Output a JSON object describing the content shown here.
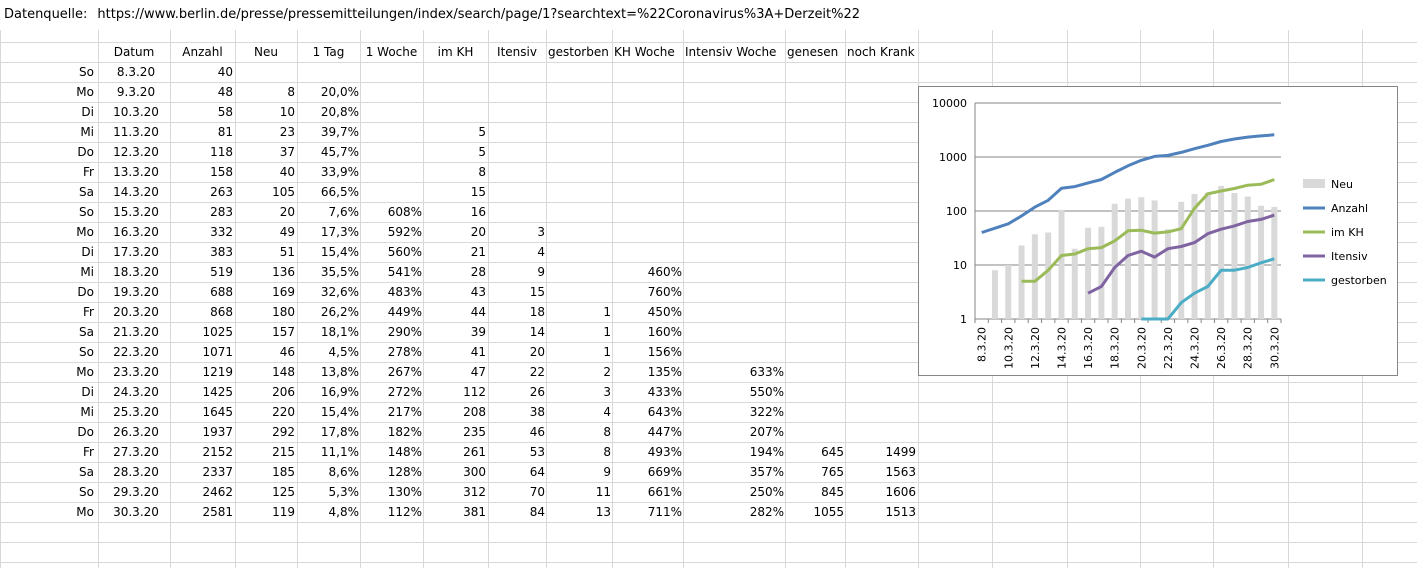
{
  "source": {
    "label": "Datenquelle:",
    "url": "https://www.berlin.de/presse/pressemitteilungen/index/search/page/1?searchtext=%22Coronavirus%3A+Derzeit%22"
  },
  "table": {
    "headers": [
      "Datum",
      "Anzahl",
      "Neu",
      "1 Tag",
      "1 Woche",
      "im KH",
      "Itensiv",
      "gestorben",
      "KH Woche",
      "Intensiv Woche",
      "genesen",
      "noch Krank"
    ],
    "rows": [
      {
        "day": "So",
        "datum": "8.3.20",
        "anzahl": "40",
        "neu": "",
        "tag1": "",
        "woche1": "",
        "kh": "",
        "intensiv": "",
        "gestorben": "",
        "khwoche": "",
        "intwoche": "",
        "genesen": "",
        "krank": ""
      },
      {
        "day": "Mo",
        "datum": "9.3.20",
        "anzahl": "48",
        "neu": "8",
        "tag1": "20,0%",
        "woche1": "",
        "kh": "",
        "intensiv": "",
        "gestorben": "",
        "khwoche": "",
        "intwoche": "",
        "genesen": "",
        "krank": ""
      },
      {
        "day": "Di",
        "datum": "10.3.20",
        "anzahl": "58",
        "neu": "10",
        "tag1": "20,8%",
        "woche1": "",
        "kh": "",
        "intensiv": "",
        "gestorben": "",
        "khwoche": "",
        "intwoche": "",
        "genesen": "",
        "krank": ""
      },
      {
        "day": "Mi",
        "datum": "11.3.20",
        "anzahl": "81",
        "neu": "23",
        "tag1": "39,7%",
        "woche1": "",
        "kh": "5",
        "intensiv": "",
        "gestorben": "",
        "khwoche": "",
        "intwoche": "",
        "genesen": "",
        "krank": ""
      },
      {
        "day": "Do",
        "datum": "12.3.20",
        "anzahl": "118",
        "neu": "37",
        "tag1": "45,7%",
        "woche1": "",
        "kh": "5",
        "intensiv": "",
        "gestorben": "",
        "khwoche": "",
        "intwoche": "",
        "genesen": "",
        "krank": ""
      },
      {
        "day": "Fr",
        "datum": "13.3.20",
        "anzahl": "158",
        "neu": "40",
        "tag1": "33,9%",
        "woche1": "",
        "kh": "8",
        "intensiv": "",
        "gestorben": "",
        "khwoche": "",
        "intwoche": "",
        "genesen": "",
        "krank": ""
      },
      {
        "day": "Sa",
        "datum": "14.3.20",
        "anzahl": "263",
        "neu": "105",
        "tag1": "66,5%",
        "woche1": "",
        "kh": "15",
        "intensiv": "",
        "gestorben": "",
        "khwoche": "",
        "intwoche": "",
        "genesen": "",
        "krank": ""
      },
      {
        "day": "So",
        "datum": "15.3.20",
        "anzahl": "283",
        "neu": "20",
        "tag1": "7,6%",
        "woche1": "608%",
        "kh": "16",
        "intensiv": "",
        "gestorben": "",
        "khwoche": "",
        "intwoche": "",
        "genesen": "",
        "krank": ""
      },
      {
        "day": "Mo",
        "datum": "16.3.20",
        "anzahl": "332",
        "neu": "49",
        "tag1": "17,3%",
        "woche1": "592%",
        "kh": "20",
        "intensiv": "3",
        "gestorben": "",
        "khwoche": "",
        "intwoche": "",
        "genesen": "",
        "krank": ""
      },
      {
        "day": "Di",
        "datum": "17.3.20",
        "anzahl": "383",
        "neu": "51",
        "tag1": "15,4%",
        "woche1": "560%",
        "kh": "21",
        "intensiv": "4",
        "gestorben": "",
        "khwoche": "",
        "intwoche": "",
        "genesen": "",
        "krank": ""
      },
      {
        "day": "Mi",
        "datum": "18.3.20",
        "anzahl": "519",
        "neu": "136",
        "tag1": "35,5%",
        "woche1": "541%",
        "kh": "28",
        "intensiv": "9",
        "gestorben": "",
        "khwoche": "460%",
        "intwoche": "",
        "genesen": "",
        "krank": ""
      },
      {
        "day": "Do",
        "datum": "19.3.20",
        "anzahl": "688",
        "neu": "169",
        "tag1": "32,6%",
        "woche1": "483%",
        "kh": "43",
        "intensiv": "15",
        "gestorben": "",
        "khwoche": "760%",
        "intwoche": "",
        "genesen": "",
        "krank": ""
      },
      {
        "day": "Fr",
        "datum": "20.3.20",
        "anzahl": "868",
        "neu": "180",
        "tag1": "26,2%",
        "woche1": "449%",
        "kh": "44",
        "intensiv": "18",
        "gestorben": "1",
        "khwoche": "450%",
        "intwoche": "",
        "genesen": "",
        "krank": ""
      },
      {
        "day": "Sa",
        "datum": "21.3.20",
        "anzahl": "1025",
        "neu": "157",
        "tag1": "18,1%",
        "woche1": "290%",
        "kh": "39",
        "intensiv": "14",
        "gestorben": "1",
        "khwoche": "160%",
        "intwoche": "",
        "genesen": "",
        "krank": ""
      },
      {
        "day": "So",
        "datum": "22.3.20",
        "anzahl": "1071",
        "neu": "46",
        "tag1": "4,5%",
        "woche1": "278%",
        "kh": "41",
        "intensiv": "20",
        "gestorben": "1",
        "khwoche": "156%",
        "intwoche": "",
        "genesen": "",
        "krank": ""
      },
      {
        "day": "Mo",
        "datum": "23.3.20",
        "anzahl": "1219",
        "neu": "148",
        "tag1": "13,8%",
        "woche1": "267%",
        "kh": "47",
        "intensiv": "22",
        "gestorben": "2",
        "khwoche": "135%",
        "intwoche": "633%",
        "genesen": "",
        "krank": ""
      },
      {
        "day": "Di",
        "datum": "24.3.20",
        "anzahl": "1425",
        "neu": "206",
        "tag1": "16,9%",
        "woche1": "272%",
        "kh": "112",
        "intensiv": "26",
        "gestorben": "3",
        "khwoche": "433%",
        "intwoche": "550%",
        "genesen": "",
        "krank": ""
      },
      {
        "day": "Mi",
        "datum": "25.3.20",
        "anzahl": "1645",
        "neu": "220",
        "tag1": "15,4%",
        "woche1": "217%",
        "kh": "208",
        "intensiv": "38",
        "gestorben": "4",
        "khwoche": "643%",
        "intwoche": "322%",
        "genesen": "",
        "krank": ""
      },
      {
        "day": "Do",
        "datum": "26.3.20",
        "anzahl": "1937",
        "neu": "292",
        "tag1": "17,8%",
        "woche1": "182%",
        "kh": "235",
        "intensiv": "46",
        "gestorben": "8",
        "khwoche": "447%",
        "intwoche": "207%",
        "genesen": "",
        "krank": ""
      },
      {
        "day": "Fr",
        "datum": "27.3.20",
        "anzahl": "2152",
        "neu": "215",
        "tag1": "11,1%",
        "woche1": "148%",
        "kh": "261",
        "intensiv": "53",
        "gestorben": "8",
        "khwoche": "493%",
        "intwoche": "194%",
        "genesen": "645",
        "krank": "1499"
      },
      {
        "day": "Sa",
        "datum": "28.3.20",
        "anzahl": "2337",
        "neu": "185",
        "tag1": "8,6%",
        "woche1": "128%",
        "kh": "300",
        "intensiv": "64",
        "gestorben": "9",
        "khwoche": "669%",
        "intwoche": "357%",
        "genesen": "765",
        "krank": "1563"
      },
      {
        "day": "So",
        "datum": "29.3.20",
        "anzahl": "2462",
        "neu": "125",
        "tag1": "5,3%",
        "woche1": "130%",
        "kh": "312",
        "intensiv": "70",
        "gestorben": "11",
        "khwoche": "661%",
        "intwoche": "250%",
        "genesen": "845",
        "krank": "1606"
      },
      {
        "day": "Mo",
        "datum": "30.3.20",
        "anzahl": "2581",
        "neu": "119",
        "tag1": "4,8%",
        "woche1": "112%",
        "kh": "381",
        "intensiv": "84",
        "gestorben": "13",
        "khwoche": "711%",
        "intwoche": "282%",
        "genesen": "1055",
        "krank": "1513"
      }
    ]
  },
  "chart_data": {
    "type": "line",
    "title": "",
    "xlabel": "",
    "ylabel": "",
    "yscale": "log",
    "ylim": [
      1,
      10000
    ],
    "y_ticks": [
      "1",
      "10",
      "100",
      "1000",
      "10000"
    ],
    "grid": true,
    "legend_position": "right",
    "x": [
      "8.3.20",
      "9.3.20",
      "10.3.20",
      "11.3.20",
      "12.3.20",
      "13.3.20",
      "14.3.20",
      "15.3.20",
      "16.3.20",
      "17.3.20",
      "18.3.20",
      "19.3.20",
      "20.3.20",
      "21.3.20",
      "22.3.20",
      "23.3.20",
      "24.3.20",
      "25.3.20",
      "26.3.20",
      "27.3.20",
      "28.3.20",
      "29.3.20",
      "30.3.20"
    ],
    "x_tick_labels": [
      "8.3.20",
      "10.3.20",
      "12.3.20",
      "14.3.20",
      "16.3.20",
      "18.3.20",
      "20.3.20",
      "22.3.20",
      "24.3.20",
      "26.3.20",
      "28.3.20",
      "30.3.20"
    ],
    "series": [
      {
        "name": "Neu",
        "kind": "bar",
        "color": "#d9d9d9",
        "values": [
          null,
          8,
          10,
          23,
          37,
          40,
          105,
          20,
          49,
          51,
          136,
          169,
          180,
          157,
          46,
          148,
          206,
          220,
          292,
          215,
          185,
          125,
          119
        ]
      },
      {
        "name": "Anzahl",
        "kind": "line",
        "color": "#4f81bd",
        "values": [
          40,
          48,
          58,
          81,
          118,
          158,
          263,
          283,
          332,
          383,
          519,
          688,
          868,
          1025,
          1071,
          1219,
          1425,
          1645,
          1937,
          2152,
          2337,
          2462,
          2581
        ]
      },
      {
        "name": "im KH",
        "kind": "line",
        "color": "#9bbb59",
        "values": [
          null,
          null,
          null,
          5,
          5,
          8,
          15,
          16,
          20,
          21,
          28,
          43,
          44,
          39,
          41,
          47,
          112,
          208,
          235,
          261,
          300,
          312,
          381
        ]
      },
      {
        "name": "Itensiv",
        "kind": "line",
        "color": "#8064a2",
        "values": [
          null,
          null,
          null,
          null,
          null,
          null,
          null,
          null,
          3,
          4,
          9,
          15,
          18,
          14,
          20,
          22,
          26,
          38,
          46,
          53,
          64,
          70,
          84
        ]
      },
      {
        "name": "gestorben",
        "kind": "line",
        "color": "#4bacc6",
        "values": [
          null,
          null,
          null,
          null,
          null,
          null,
          null,
          null,
          null,
          null,
          null,
          null,
          1,
          1,
          1,
          2,
          3,
          4,
          8,
          8,
          9,
          11,
          13
        ]
      }
    ]
  }
}
